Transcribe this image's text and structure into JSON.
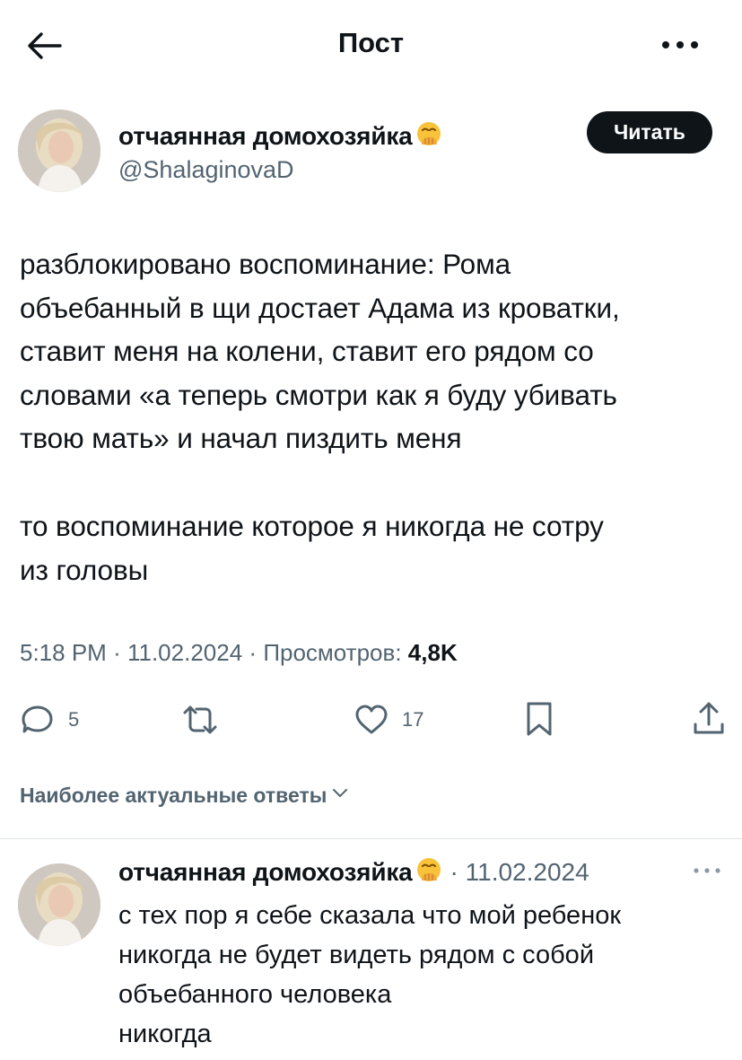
{
  "header": {
    "title": "Пост",
    "back_icon": "arrow-left-icon",
    "more_icon": "more-horizontal-icon"
  },
  "post": {
    "author_name": "отчаянная домохозяйка",
    "author_emoji": "hand-over-mouth-emoji",
    "author_handle": "@ShalaginovaD",
    "follow_label": "Читать",
    "text_paragraph_1": "разблокировано воспоминание: Рома\nобъебанный в щи достает Адама из кроватки,\nставит меня на колени, ставит его рядом со\nсловами «а теперь смотри как я буду убивать\nтвою мать» и начал пиздить меня",
    "text_paragraph_2": "то воспоминание которое я никогда не сотру\nиз головы",
    "time": "5:18 PM",
    "date": "11.02.2024",
    "views_label": "Просмотров:",
    "views_count": "4,8K",
    "separator": "·"
  },
  "actions": {
    "reply": {
      "icon": "reply-icon",
      "count": "5"
    },
    "retweet": {
      "icon": "retweet-icon",
      "count": ""
    },
    "like": {
      "icon": "heart-icon",
      "count": "17"
    },
    "bookmark": {
      "icon": "bookmark-icon"
    },
    "share": {
      "icon": "share-icon"
    }
  },
  "replies_sort": {
    "label": "Наиболее актуальные ответы",
    "icon": "chevron-down-icon"
  },
  "reply": {
    "author_name": "отчаянная домохозяйка",
    "date": "· 11.02.2024",
    "more_icon": "more-horizontal-icon",
    "lines": [
      "с тех пор я себе сказала что мой ребенок",
      "никогда не будет видеть рядом с собой",
      "объебанного человека",
      "никогда"
    ]
  },
  "colors": {
    "text": "#0f1419",
    "secondary": "#536471",
    "button_bg": "#0f1419",
    "divider": "#dfe3e6"
  }
}
